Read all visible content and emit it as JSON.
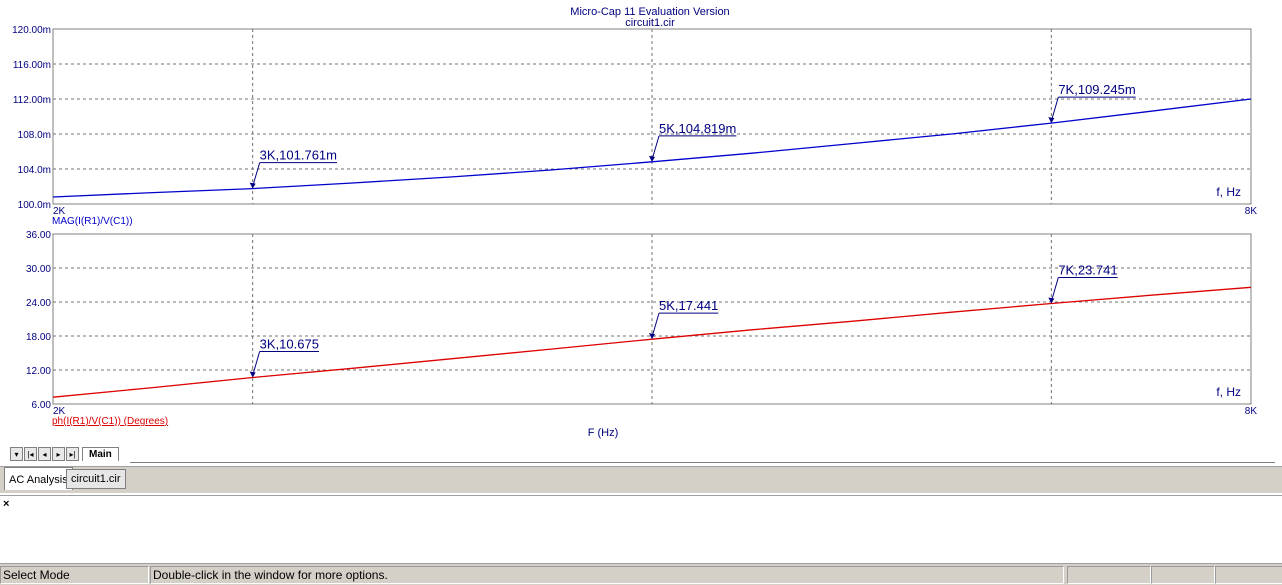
{
  "window": {
    "title": "Micro-Cap 11 Evaluation Version",
    "subtitle": "circuit1.cir"
  },
  "x_axis_label": "F (Hz)",
  "colors": {
    "mag": "#0000cc",
    "phase": "#dd0000",
    "label": "#000080",
    "grid": "#707070"
  },
  "chart_data": [
    {
      "type": "line",
      "xlim": [
        2000,
        8000
      ],
      "ylim": [
        0.1,
        0.12
      ],
      "x_tick_labels": [
        "2K",
        "8K"
      ],
      "y_tick_labels": [
        "100.0m",
        "104.0m",
        "108.0m",
        "112.00m",
        "116.00m",
        "120.00m"
      ],
      "x_gridlines": [
        3000,
        5000,
        7000
      ],
      "corner_label": "f, Hz",
      "series": [
        {
          "name": "MAG(I(R1)/V(C1))",
          "x": [
            2000,
            2500,
            3000,
            3500,
            4000,
            4500,
            5000,
            5500,
            6000,
            6500,
            7000,
            7500,
            8000
          ],
          "y": [
            0.1008,
            0.1013,
            0.10176,
            0.1024,
            0.1031,
            0.1039,
            0.10482,
            0.1058,
            0.1069,
            0.108,
            0.10925,
            0.1106,
            0.112
          ]
        }
      ],
      "annotations": [
        {
          "x": 3000,
          "y": 0.101761,
          "text": "3K,101.761m"
        },
        {
          "x": 5000,
          "y": 0.104819,
          "text": "5K,104.819m"
        },
        {
          "x": 7000,
          "y": 0.109245,
          "text": "7K,109.245m"
        }
      ]
    },
    {
      "type": "line",
      "xlim": [
        2000,
        8000
      ],
      "ylim": [
        6,
        36
      ],
      "x_tick_labels": [
        "2K",
        "8K"
      ],
      "y_tick_labels": [
        "6.00",
        "12.00",
        "18.00",
        "24.00",
        "30.00",
        "36.00"
      ],
      "x_gridlines": [
        3000,
        5000,
        7000
      ],
      "corner_label": "f, Hz",
      "series": [
        {
          "name": "ph(I(R1)/V(C1)) (Degrees)",
          "x": [
            2000,
            2500,
            3000,
            3500,
            4000,
            4500,
            5000,
            5500,
            6000,
            6500,
            7000,
            7500,
            8000
          ],
          "y": [
            7.2,
            8.9,
            10.675,
            12.3,
            14.0,
            15.7,
            17.441,
            19.1,
            20.6,
            22.2,
            23.741,
            25.2,
            26.6
          ]
        }
      ],
      "annotations": [
        {
          "x": 3000,
          "y": 10.675,
          "text": "3K,10.675"
        },
        {
          "x": 5000,
          "y": 17.441,
          "text": "5K,17.441"
        },
        {
          "x": 7000,
          "y": 23.741,
          "text": "7K,23.741"
        }
      ]
    }
  ],
  "tabs": {
    "main": "Main"
  },
  "doc_tabs": [
    "AC Analysis",
    "circuit1.cir"
  ],
  "status": {
    "mode": "Select Mode",
    "hint": "Double-click in the window for more options."
  }
}
